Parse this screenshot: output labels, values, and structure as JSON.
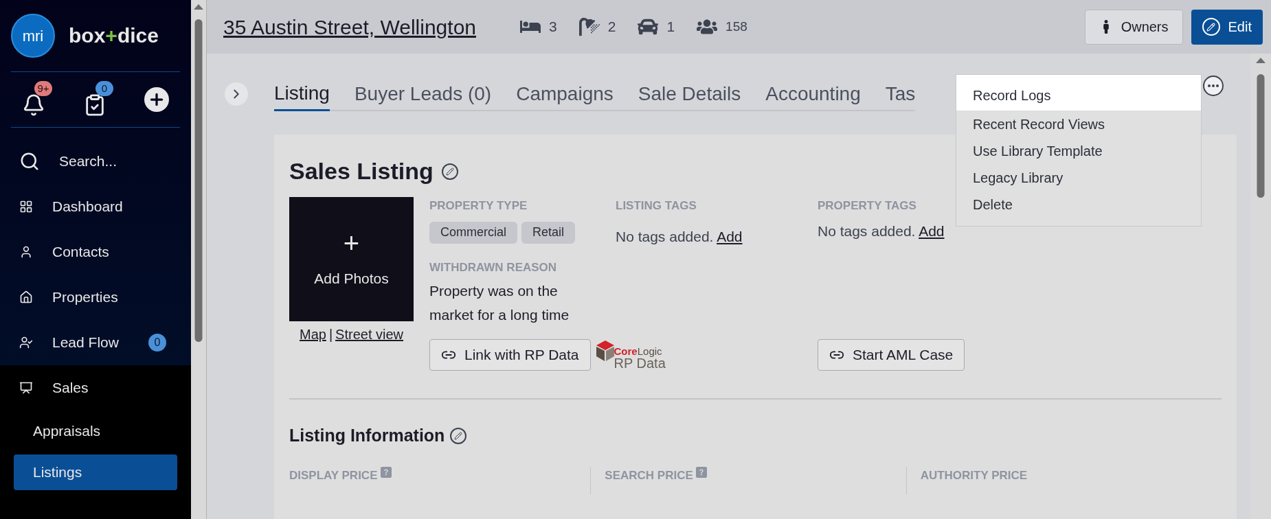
{
  "sidebar": {
    "logo": {
      "mark": "mri",
      "brand_left": "box",
      "brand_plus": "+",
      "brand_right": "dice"
    },
    "quick_actions": [
      {
        "kind": "notifications",
        "badge": "9+"
      },
      {
        "kind": "tasks",
        "badge": "0"
      },
      {
        "kind": "add"
      }
    ],
    "items": [
      {
        "kind": "search",
        "label": "Search...",
        "selected": false
      },
      {
        "kind": "dashboard",
        "label": "Dashboard",
        "selected": false
      },
      {
        "kind": "contacts",
        "label": "Contacts",
        "selected": false
      },
      {
        "kind": "properties",
        "label": "Properties",
        "selected": false
      },
      {
        "kind": "leadflow",
        "label": "Lead Flow",
        "badge": "0",
        "selected": false
      },
      {
        "kind": "sales",
        "label": "Sales",
        "selected": false,
        "children": [
          {
            "label": "Appraisals",
            "selected": false
          },
          {
            "label": "Listings",
            "selected": true
          }
        ]
      }
    ]
  },
  "header": {
    "title": "35 Austin Street, Wellington",
    "stats": [
      {
        "kind": "bed",
        "value": "3"
      },
      {
        "kind": "bath",
        "value": "2"
      },
      {
        "kind": "car",
        "value": "1"
      },
      {
        "kind": "people",
        "value": "158"
      }
    ],
    "buttons": [
      {
        "kind": "owners",
        "label": "Owners"
      },
      {
        "kind": "edit",
        "label": "Edit"
      }
    ]
  },
  "tabs": [
    {
      "label": "Listing",
      "selected": true
    },
    {
      "label": "Buyer Leads (0)",
      "selected": false
    },
    {
      "label": "Campaigns",
      "selected": false
    },
    {
      "label": "Sale Details",
      "selected": false
    },
    {
      "label": "Accounting",
      "selected": false
    },
    {
      "label": "Tas",
      "selected": false
    }
  ],
  "menu": {
    "items": [
      {
        "label": "Record Logs",
        "selected": true
      },
      {
        "label": "Recent Record Views",
        "selected": false
      },
      {
        "label": "Use Library Template",
        "selected": false
      },
      {
        "label": "Legacy Library",
        "selected": false
      },
      {
        "label": "Delete",
        "selected": false
      }
    ]
  },
  "card": {
    "title": "Sales Listing",
    "photo": {
      "plus": "+",
      "label": "Add Photos"
    },
    "photo_links": [
      "Map",
      "|",
      "Street view"
    ],
    "property_type": {
      "label": "PROPERTY TYPE",
      "tags": [
        "Commercial",
        "Retail"
      ]
    },
    "withdrawn_reason": {
      "label": "WITHDRAWN REASON",
      "text": "Property was on the market for a long time"
    },
    "listing_tags": {
      "label": "LISTING TAGS",
      "empty": "No tags added.",
      "action": "Add"
    },
    "property_tags": {
      "label": "PROPERTY TAGS",
      "empty": "No tags added.",
      "action": "Add"
    },
    "rp_button": "Link with RP Data",
    "rp_logo": {
      "brand_a": "Core",
      "brand_b": "Logic",
      "sub": "RP Data"
    },
    "aml_button": "Start AML Case",
    "section_title": "Listing Information",
    "price_columns": [
      {
        "label": "DISPLAY PRICE",
        "help": true
      },
      {
        "label": "SEARCH PRICE",
        "help": true
      },
      {
        "label": "AUTHORITY PRICE",
        "help": false
      }
    ]
  }
}
